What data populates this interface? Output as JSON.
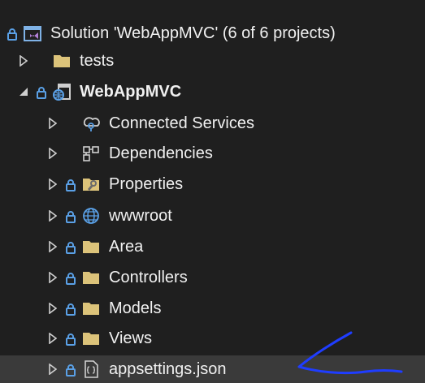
{
  "colors": {
    "background": "#1f1f1f",
    "text": "#f1f1f1",
    "selected_row": "#3a3a3a",
    "lock": "#5aa0e6",
    "folder": "#dcc37a",
    "solution": "#7fb2e6",
    "globe": "#5aa0e6",
    "annotation_stroke": "#1f3dff"
  },
  "tree": {
    "solution": {
      "label": "Solution 'WebAppMVC' (6 of 6 projects)",
      "icon": "solution-icon"
    },
    "tests": {
      "label": "tests",
      "icon": "folder-icon"
    },
    "project": {
      "label": "WebAppMVC",
      "icon": "project-icon"
    },
    "connected_services": {
      "label": "Connected Services",
      "icon": "connected-services-icon"
    },
    "dependencies": {
      "label": "Dependencies",
      "icon": "dependencies-icon"
    },
    "properties": {
      "label": "Properties",
      "icon": "properties-folder-icon"
    },
    "wwwroot": {
      "label": "wwwroot",
      "icon": "globe-icon"
    },
    "area": {
      "label": "Area",
      "icon": "folder-icon"
    },
    "controllers": {
      "label": "Controllers",
      "icon": "folder-icon"
    },
    "models": {
      "label": "Models",
      "icon": "folder-icon"
    },
    "views": {
      "label": "Views",
      "icon": "folder-icon"
    },
    "appsettings": {
      "label": "appsettings.json",
      "icon": "json-file-icon",
      "selected": true
    }
  }
}
